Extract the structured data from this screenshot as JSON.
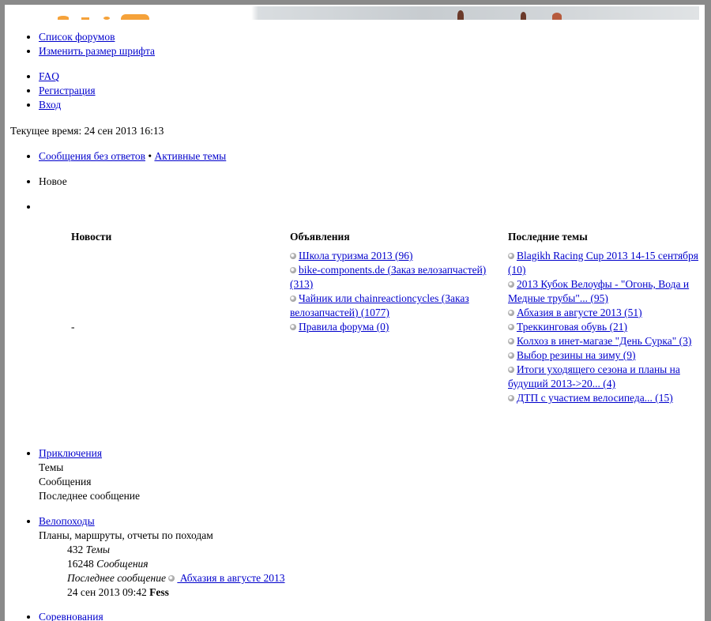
{
  "top_nav": {
    "group1": [
      "Список форумов",
      "Изменить размер шрифта"
    ],
    "group2": [
      "FAQ",
      "Регистрация",
      "Вход"
    ]
  },
  "current_time": "Текущее время: 24 сен 2013 16:13",
  "search_links": {
    "unanswered": "Сообщения без ответов",
    "separator": "•",
    "active": "Активные темы"
  },
  "new_label": "Новое",
  "columns": {
    "news": {
      "title": "Новости",
      "placeholder": "-"
    },
    "announcements": {
      "title": "Объявления",
      "items": [
        "Школа туризма 2013 (96)",
        "bike-components.de (Заказ велозапчастей) (313)",
        "Чайник или chainreactioncycles (Заказ велозапчастей) (1077)",
        "Правила форума (0)"
      ]
    },
    "recent": {
      "title": "Последние темы",
      "items": [
        "Blagikh Racing Cup 2013 14-15 сентября (10)",
        "2013 Кубок Велоуфы - \"Огонь, Вода и Медные трубы\"... (95)",
        "Абхазия в августе 2013 (51)",
        "Треккинговая обувь (21)",
        "Колхоз в инет-магазе \"День Сурка\" (3)",
        "Выбор резины на зиму (9)",
        "Итоги уходящего сезона и планы на будущий 2013->20... (4)",
        "ДТП с участием велосипеда... (15)"
      ]
    }
  },
  "forums": [
    {
      "name": "Приключения",
      "topics_label": "Темы",
      "posts_label": "Сообщения",
      "last_label": "Последнее сообщение"
    },
    {
      "name": "Велопоходы",
      "description": "Планы, маршруты, отчеты по походам",
      "topics": "432",
      "topics_label": "Темы",
      "posts": "16248",
      "posts_label": "Сообщения",
      "last_label": "Последнее сообщение",
      "last_topic": " Абхазия в августе 2013 ",
      "last_time": "24 сен 2013 09:42",
      "last_user": "Fess"
    },
    {
      "name": "Соревнования"
    }
  ]
}
